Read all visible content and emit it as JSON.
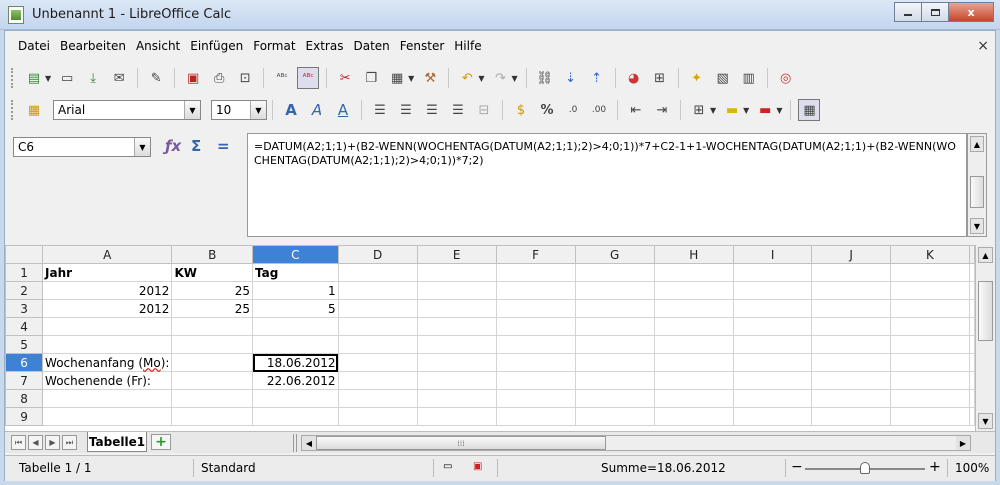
{
  "window": {
    "title": "Unbenannt 1 - LibreOffice Calc",
    "min_label": "–",
    "max_label": "□",
    "close_label": "x"
  },
  "menu": {
    "items": [
      "Datei",
      "Bearbeiten",
      "Ansicht",
      "Einfügen",
      "Format",
      "Extras",
      "Daten",
      "Fenster",
      "Hilfe"
    ],
    "close_doc": "×"
  },
  "format_toolbar": {
    "font_name": "Arial",
    "font_size": "10"
  },
  "formula_bar": {
    "cell_ref": "C6",
    "formula": "=DATUM(A2;1;1)+(B2-WENN(WOCHENTAG(DATUM(A2;1;1);2)>4;0;1))*7+C2-1+1-WOCHENTAG(DATUM(A2;1;1)+(B2-WENN(WOCHENTAG(DATUM(A2;1;1);2)>4;0;1))*7;2)"
  },
  "sheet": {
    "columns": [
      "A",
      "B",
      "C",
      "D",
      "E",
      "F",
      "G",
      "H",
      "I",
      "J",
      "K"
    ],
    "selected_column": "C",
    "selected_row": 6,
    "rows": [
      {
        "n": "1",
        "A": "Jahr",
        "B": "KW",
        "C": "Tag"
      },
      {
        "n": "2",
        "A": "2012",
        "B": "25",
        "C": "1"
      },
      {
        "n": "3",
        "A": "2012",
        "B": "25",
        "C": "5"
      },
      {
        "n": "4",
        "A": "",
        "B": "",
        "C": ""
      },
      {
        "n": "5",
        "A": "",
        "B": "",
        "C": ""
      },
      {
        "n": "6",
        "A": "Wochenanfang (Mo):",
        "B": "",
        "C": "18.06.2012"
      },
      {
        "n": "7",
        "A": "Wochenende (Fr):",
        "B": "",
        "C": "22.06.2012"
      },
      {
        "n": "8",
        "A": "",
        "B": "",
        "C": ""
      },
      {
        "n": "9",
        "A": "",
        "B": "",
        "C": ""
      }
    ]
  },
  "tabs": {
    "active": "Tabelle1",
    "add": "+"
  },
  "status": {
    "sheet_pos": "Tabelle 1 / 1",
    "style": "Standard",
    "sum": "Summe=18.06.2012",
    "zoom_minus": "−",
    "zoom_plus": "+",
    "zoom": "100%",
    "zoom_level": 1.0
  }
}
